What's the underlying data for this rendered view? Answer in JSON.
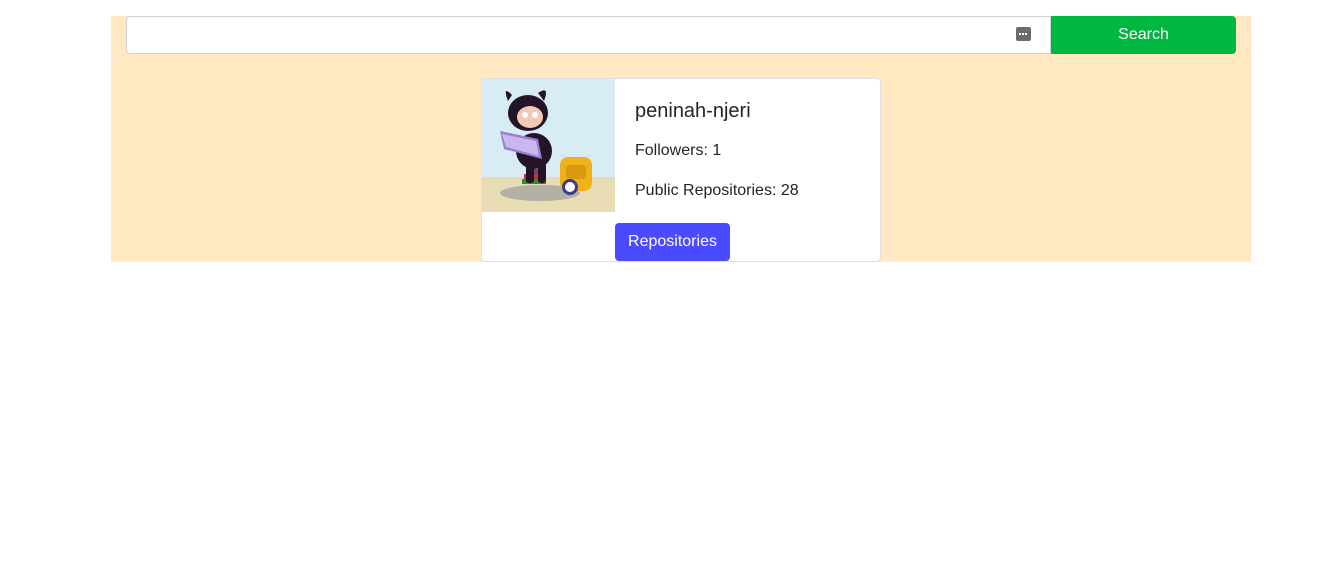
{
  "search": {
    "value": "",
    "placeholder": "",
    "button_label": "Search",
    "autofill_icon": "password-manager-icon"
  },
  "profile": {
    "avatar_icon": "octocat-avatar",
    "username": "peninah-njeri",
    "followers_text": "Followers: 1",
    "public_repos_text": "Public Repositories: 28",
    "repos_button_label": "Repositories"
  },
  "colors": {
    "background_panel": "#ffe8c2",
    "search_button": "#00b73f",
    "repos_button": "#4a4aff"
  }
}
